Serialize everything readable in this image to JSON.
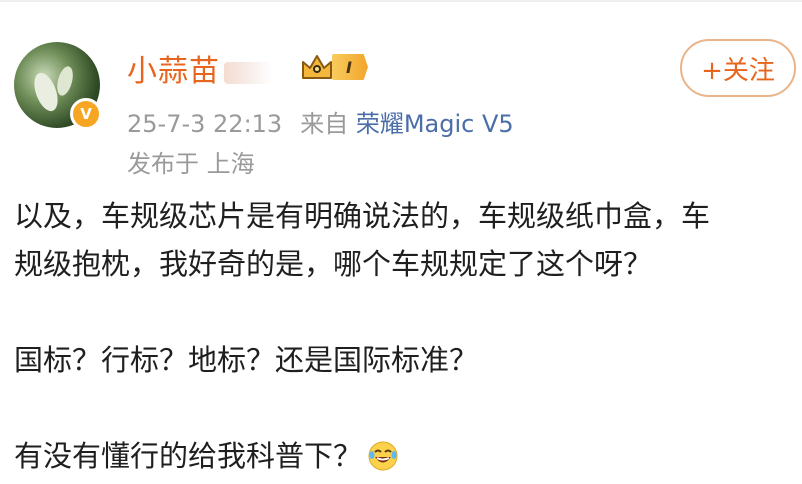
{
  "user": {
    "name": "小蒜苗",
    "vip_level": "I"
  },
  "follow_button": {
    "label": "+关注"
  },
  "meta": {
    "timestamp": "25-7-3 22:13",
    "source_prefix": "来自",
    "device": "荣耀Magic V5",
    "location": "发布于 上海"
  },
  "post": {
    "lines": [
      "以及，车规级芯片是有明确说法的，车规级纸巾盒，车",
      "规级抱枕，我好奇的是，哪个车规规定了这个呀？",
      "国标？行标？地标？还是国际标准？",
      "有没有懂行的给我科普下？"
    ],
    "trailing_emoji": "laughing-tears-emoji"
  },
  "icons": {
    "verified": "verified-badge-icon",
    "crown": "crown-icon"
  },
  "colors": {
    "username": "#e8651d",
    "follow_border": "#e9b48a",
    "meta_text": "#9a9a9a",
    "device_link": "#4b6ea8",
    "vip_gold": "#f3a52b"
  }
}
